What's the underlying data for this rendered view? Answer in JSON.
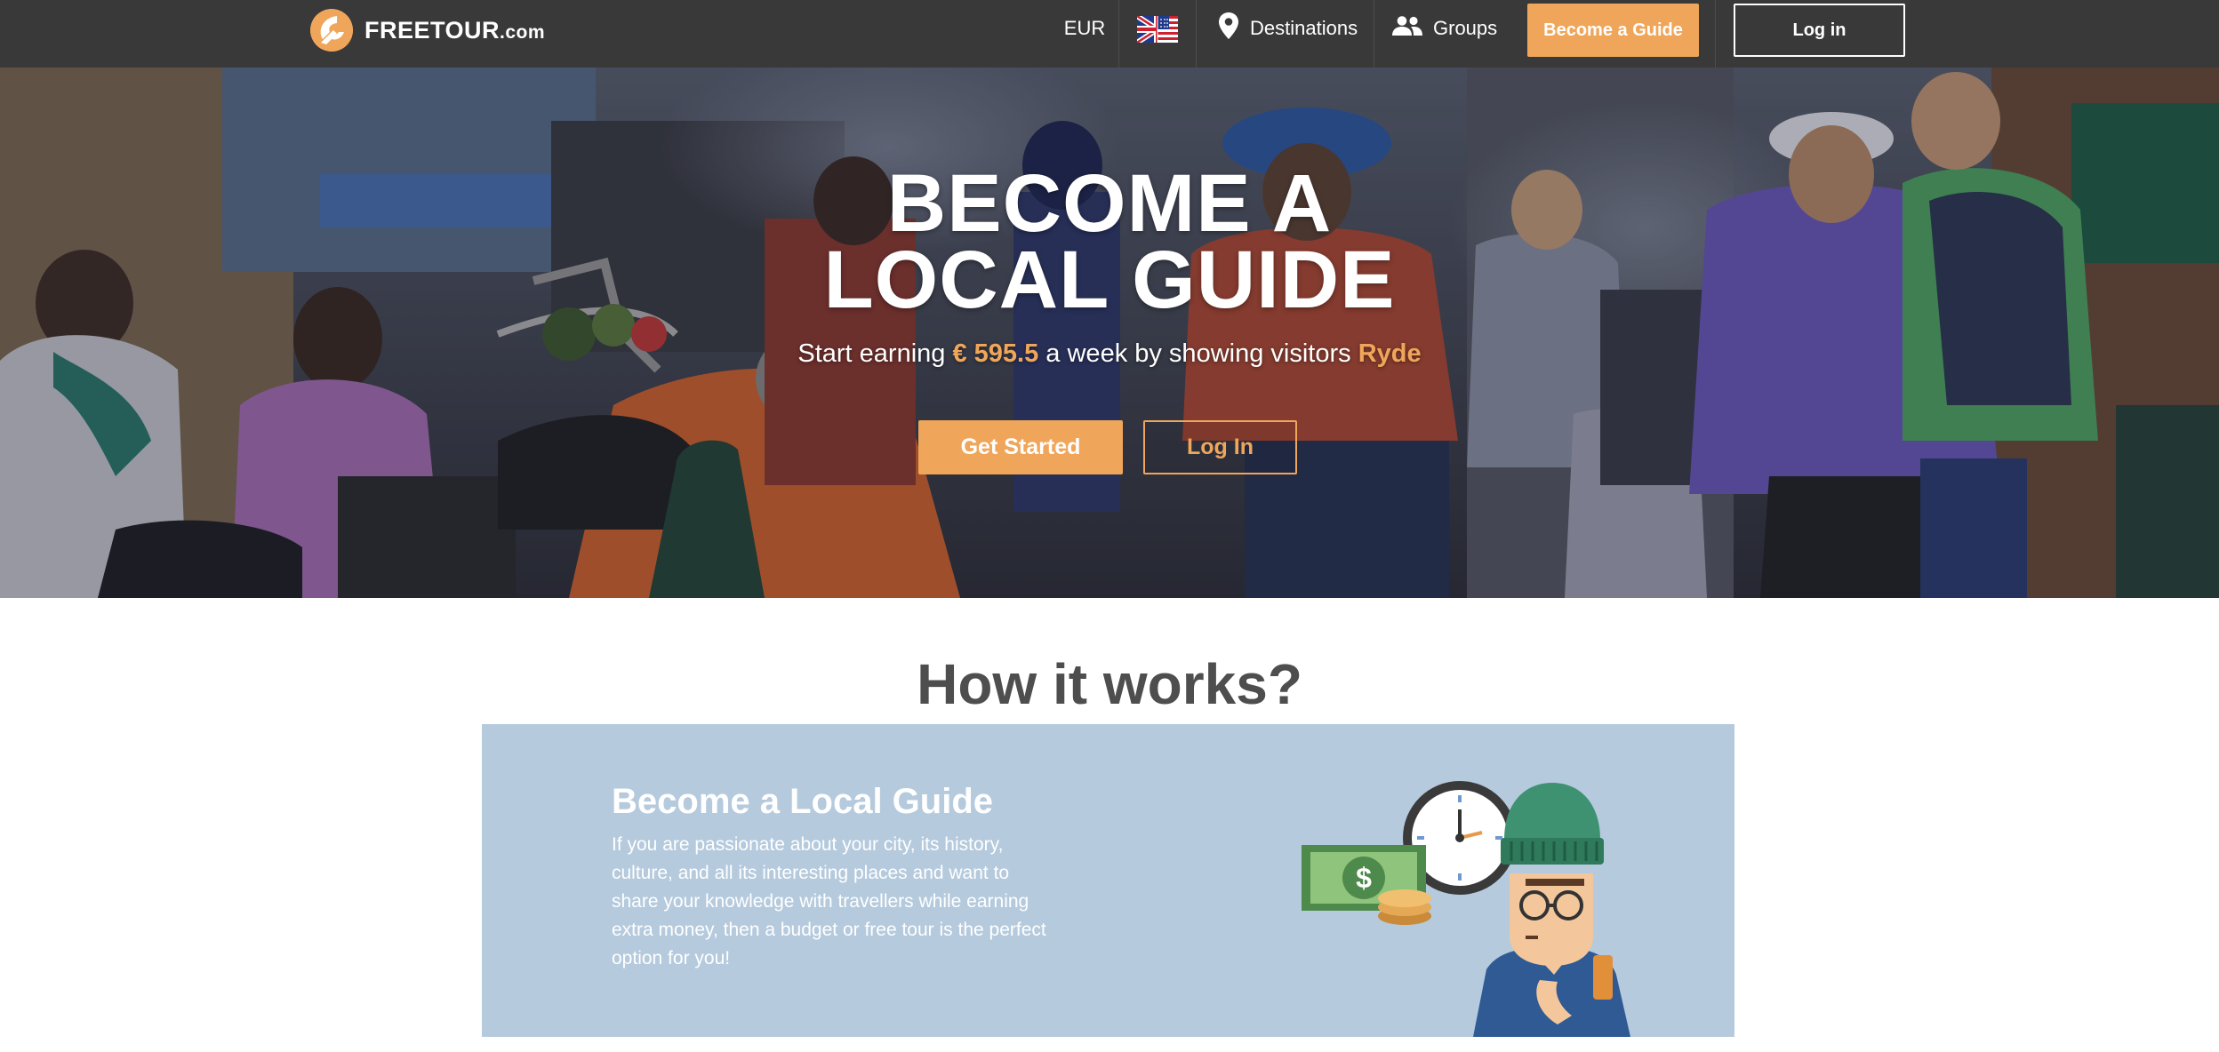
{
  "navbar": {
    "logo_text": "FREETOUR",
    "logo_suffix": ".com",
    "currency": "EUR",
    "flag_icon": "uk-us-flag-icon",
    "destinations_label": "Destinations",
    "groups_label": "Groups",
    "become_guide_label": "Become a Guide",
    "login_label": "Log in"
  },
  "hero": {
    "title_line1": "BECOME A",
    "title_line2": "LOCAL GUIDE",
    "subtitle_prefix": "Start earning ",
    "amount": "€ 595.5",
    "subtitle_middle": " a week by showing visitors ",
    "city": "Ryde",
    "get_started_label": "Get Started",
    "login_label": "Log In"
  },
  "how_it_works": {
    "title": "How it works?",
    "card_title": "Become a Local Guide",
    "card_text": "If you are passionate about your city, its history, culture, and all its interesting places and want to share your knowledge with travellers while earning extra money, then a budget or free tour is the perfect option for you!"
  },
  "colors": {
    "navbar_bg": "#393939",
    "accent": "#f0a65a",
    "card_bg": "#b5cadd",
    "heading": "#4e4e4e"
  }
}
